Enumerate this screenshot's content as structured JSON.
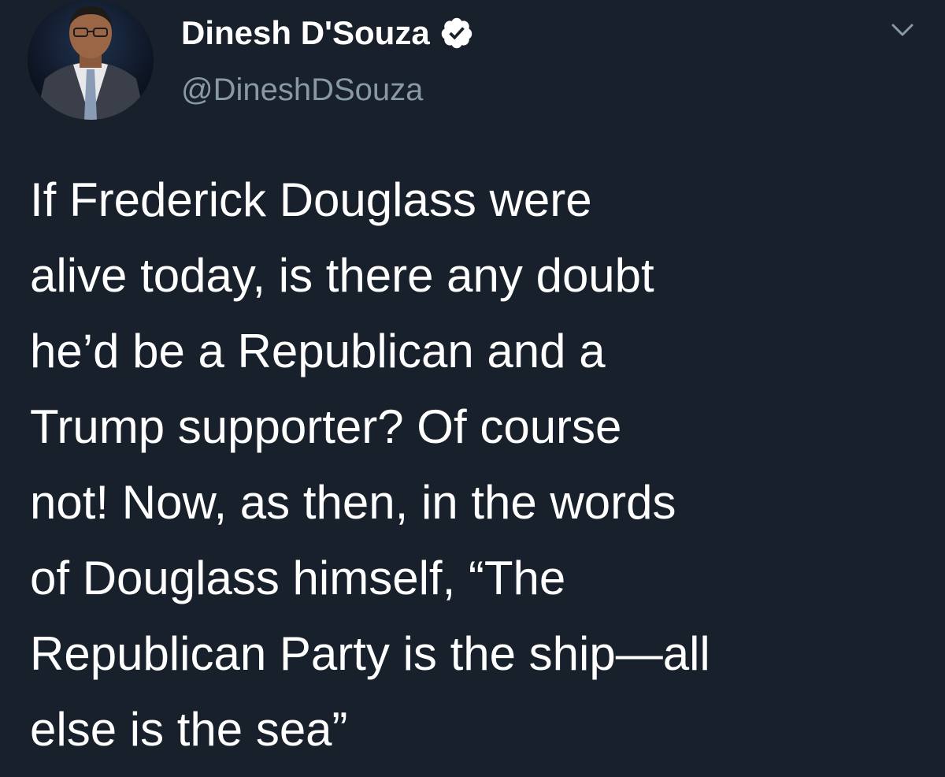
{
  "author": {
    "display_name": "Dinesh D'Souza",
    "handle": "@DineshDSouza",
    "verified": true,
    "avatar_icon": "profile-photo"
  },
  "menu": {
    "icon": "chevron-down-icon"
  },
  "tweet": {
    "lines": [
      "If Frederick Douglass were",
      "alive today, is there any doubt",
      "he’d be a Republican and a",
      "Trump supporter? Of course",
      "not! Now, as then, in the words",
      "of Douglass himself, “The",
      "Republican Party is the ship—all",
      "else is the sea”"
    ]
  },
  "colors": {
    "background": "#18202b",
    "text": "#ffffff",
    "handle": "#8899a6",
    "verified_badge": "#ffffff"
  }
}
